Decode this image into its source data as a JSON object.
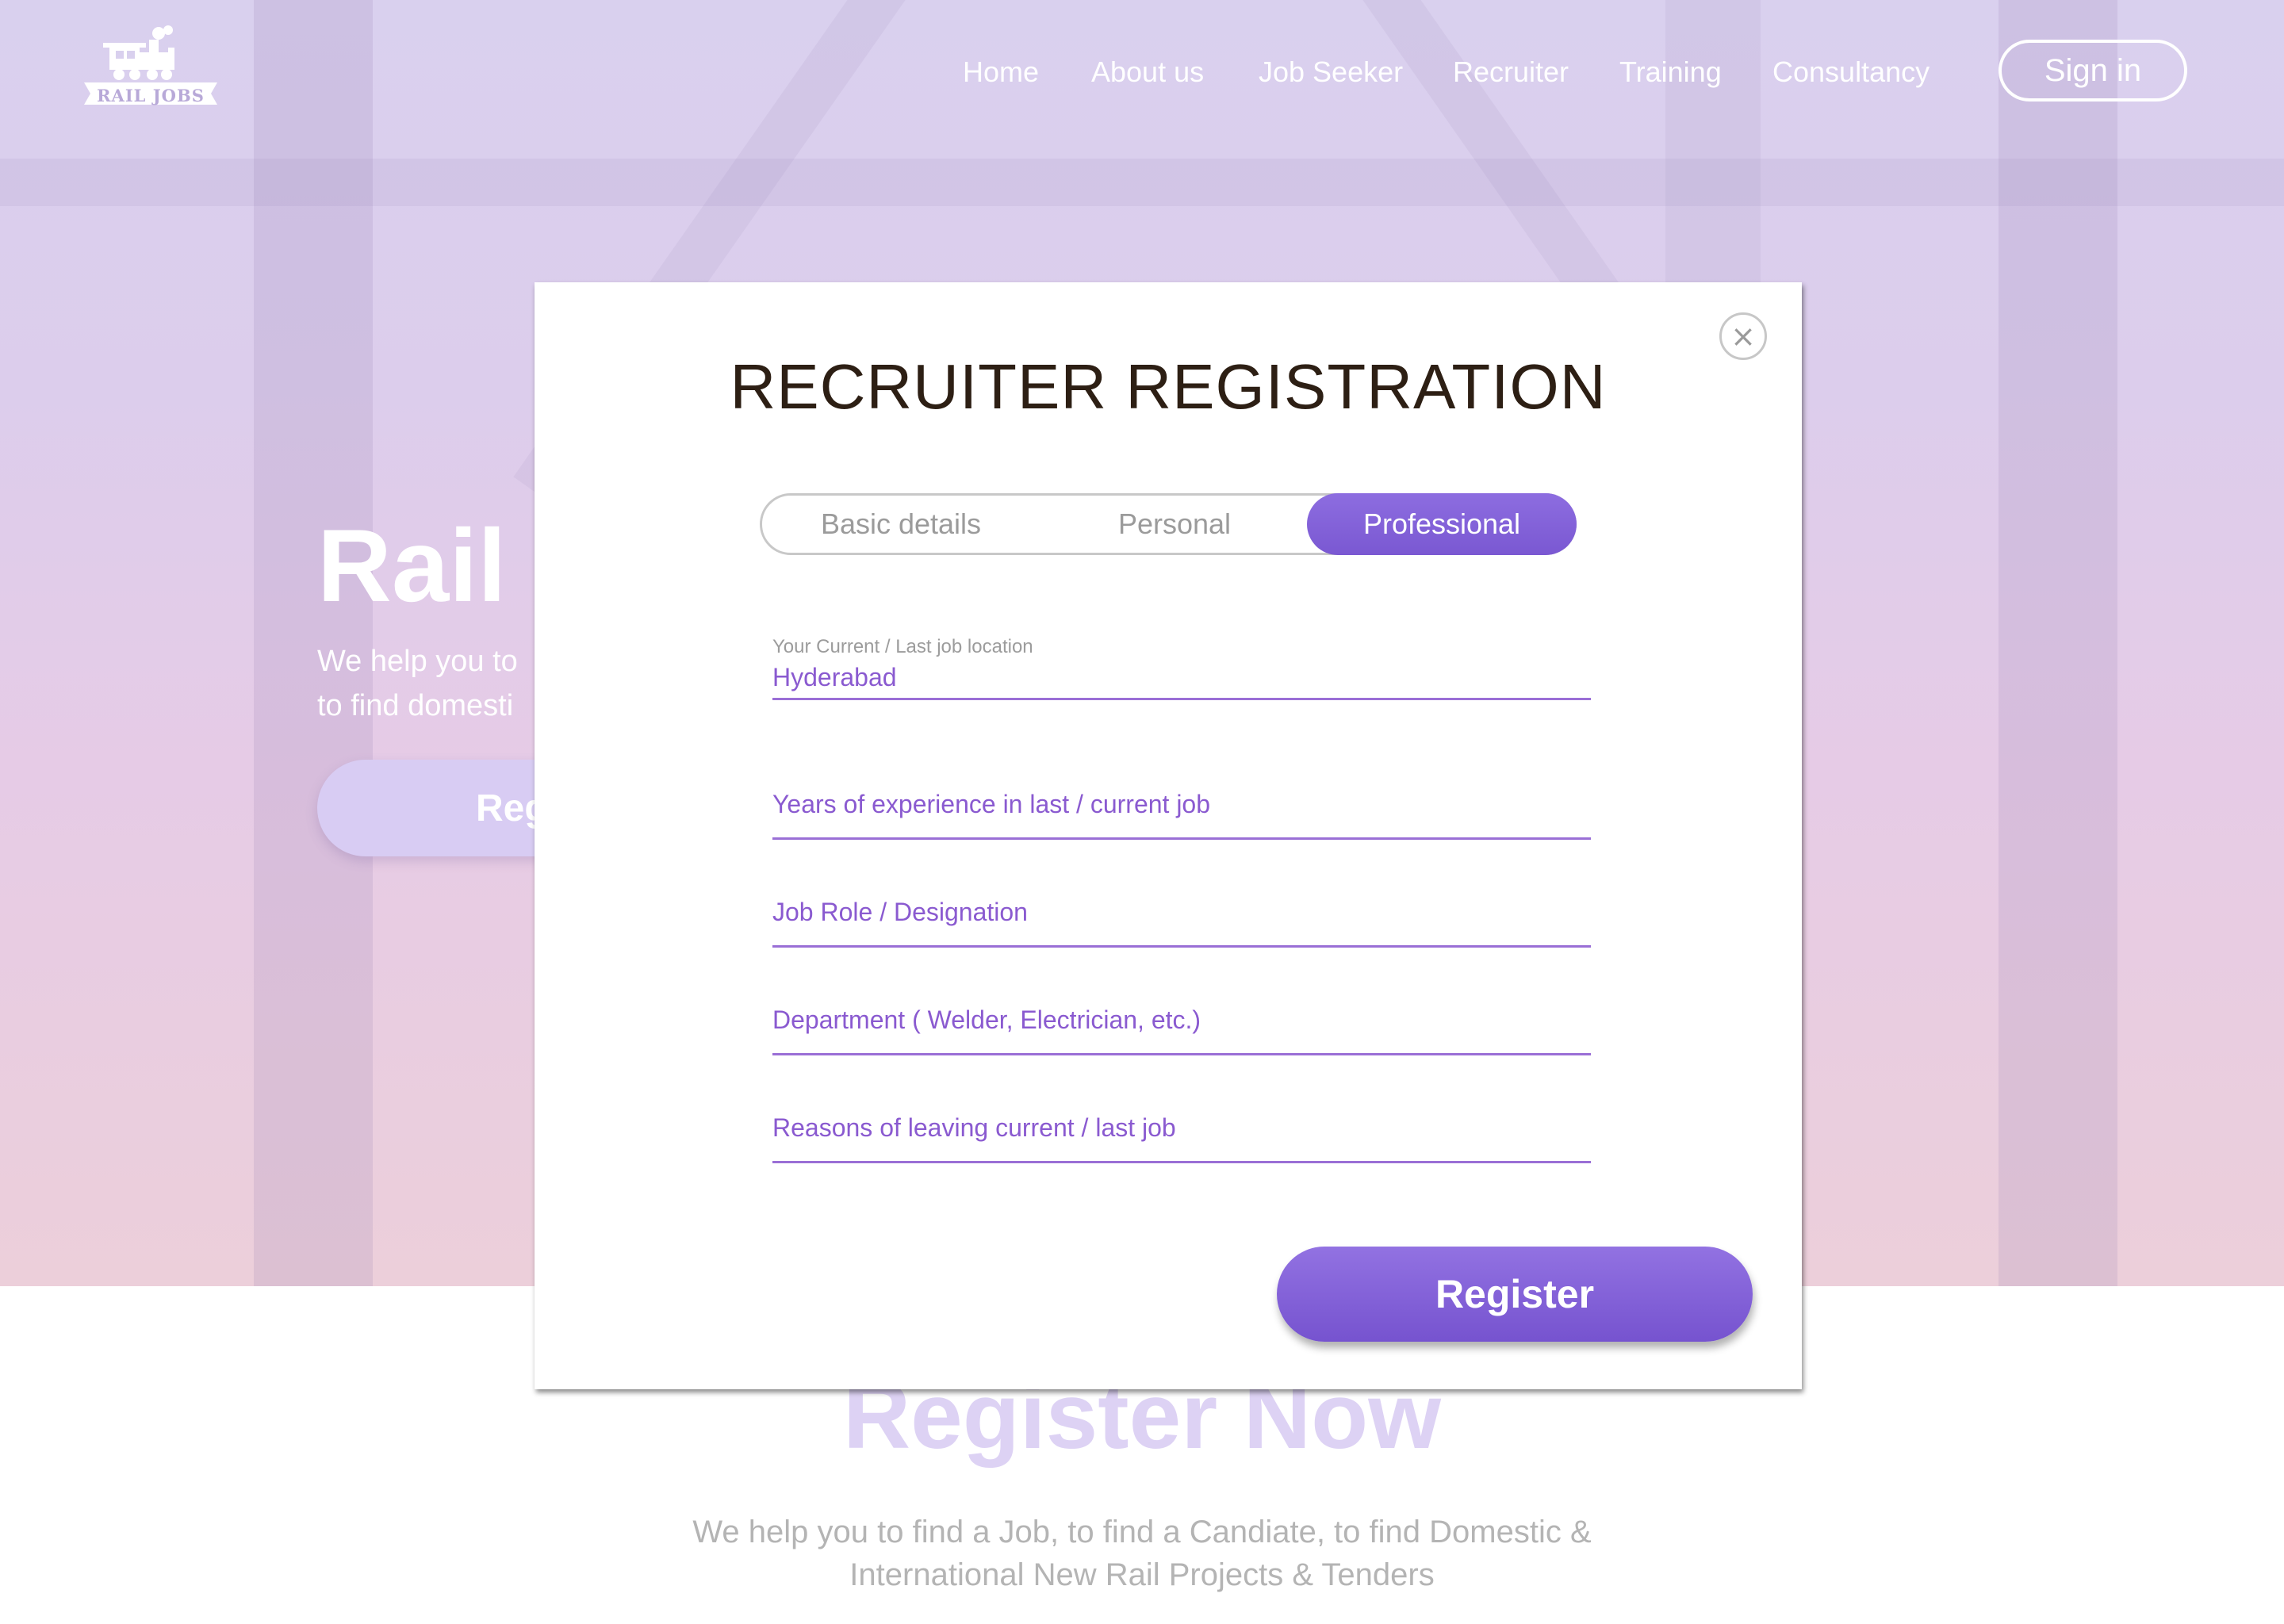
{
  "brand": {
    "logo_text": "RAIL JOBS"
  },
  "nav": {
    "items": [
      "Home",
      "About us",
      "Job Seeker",
      "Recruiter",
      "Training",
      "Consultancy"
    ],
    "signin_label": "Sign in"
  },
  "hero": {
    "title": "Rail J",
    "subtitle_line1": "We help you to",
    "subtitle_line2": "to find domesti",
    "button_label": "Reg"
  },
  "lower": {
    "heading": "Register Now",
    "desc_line1": "We help you to find a Job, to find a Candiate, to find Domestic &",
    "desc_line2": "International New Rail Projects & Tenders"
  },
  "modal": {
    "title": "RECRUITER REGISTRATION",
    "close_glyph": "×",
    "steps": [
      "Basic details",
      "Personal",
      "Professional"
    ],
    "active_step": "Professional",
    "fields": {
      "location_label": "Your Current / Last job location",
      "location_value": "Hyderabad",
      "experience_placeholder": "Years of experience in last / current job",
      "role_placeholder": "Job Role / Designation",
      "department_placeholder": "Department ( Welder, Electrician, etc.)",
      "reasons_placeholder": "Reasons of leaving current / last job"
    },
    "register_label": "Register"
  },
  "colors": {
    "accent": "#7a58d2",
    "field_text": "#8a5ad0",
    "title_text": "#2d1f14"
  }
}
